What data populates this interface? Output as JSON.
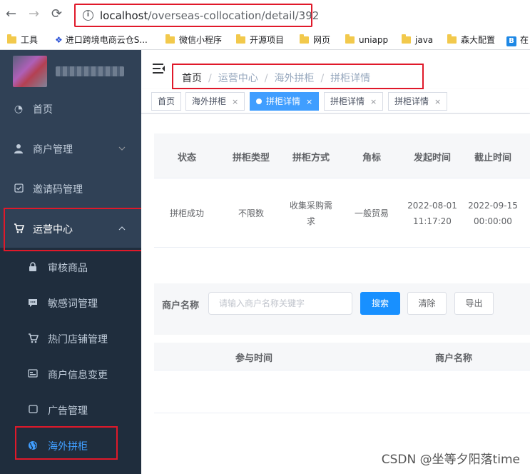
{
  "browser": {
    "url_host": "localhost",
    "url_path": "/overseas-collocation/detail/392",
    "bookmarks": [
      {
        "label": "工具",
        "icon": "folder-icon"
      },
      {
        "label": "进口跨境电商云仓S...",
        "icon": "paw-icon"
      },
      {
        "label": "微信小程序",
        "icon": "folder-icon"
      },
      {
        "label": "开源项目",
        "icon": "folder-icon"
      },
      {
        "label": "网页",
        "icon": "folder-icon"
      },
      {
        "label": "uniapp",
        "icon": "folder-icon"
      },
      {
        "label": "java",
        "icon": "folder-icon"
      },
      {
        "label": "森大配置",
        "icon": "folder-icon"
      },
      {
        "label": "在",
        "icon": "b-icon"
      }
    ]
  },
  "sidebar": {
    "menu": [
      {
        "label": "首页",
        "icon": "dashboard-icon"
      },
      {
        "label": "商户管理",
        "icon": "user-icon"
      },
      {
        "label": "邀请码管理",
        "icon": "checkbox-icon"
      },
      {
        "label": "运营中心",
        "icon": "cart-icon"
      }
    ],
    "submenu": [
      {
        "label": "审核商品",
        "icon": "lock-icon"
      },
      {
        "label": "敏感词管理",
        "icon": "message-icon"
      },
      {
        "label": "热门店铺管理",
        "icon": "cart-icon"
      },
      {
        "label": "商户信息变更",
        "icon": "id-card-icon"
      },
      {
        "label": "广告管理",
        "icon": "screen-icon"
      },
      {
        "label": "海外拼柜",
        "icon": "globe-icon"
      }
    ]
  },
  "breadcrumb": [
    "首页",
    "运营中心",
    "海外拼柜",
    "拼柜详情"
  ],
  "tags": [
    {
      "label": "首页"
    },
    {
      "label": "海外拼柜"
    },
    {
      "label": "拼柜详情"
    },
    {
      "label": "拼柜详情"
    },
    {
      "label": "拼柜详情"
    }
  ],
  "detail_table": {
    "headers": [
      "状态",
      "拼柜类型",
      "拼柜方式",
      "角标",
      "发起时间",
      "截止时间"
    ],
    "row": {
      "status": "拼柜成功",
      "type": "不限数",
      "method": "收集采购需求",
      "badge": "一般贸易",
      "start_date": "2022-08-01",
      "start_time": "11:17:20",
      "end_date": "2022-09-15",
      "end_time": "00:00:00"
    }
  },
  "search": {
    "label": "商户名称",
    "placeholder": "请输入商户名称关键字",
    "search_btn": "搜索",
    "clear_btn": "清除",
    "export_btn": "导出"
  },
  "participants_table": {
    "headers": [
      "参与时间",
      "商户名称"
    ]
  },
  "watermark": "CSDN @坐等夕阳落time",
  "colors": {
    "sidebar_bg": "#304156",
    "submenu_bg": "#1f2d3d",
    "accent": "#409eff",
    "primary_button": "#1890ff",
    "highlight_box": "#e0192a"
  }
}
